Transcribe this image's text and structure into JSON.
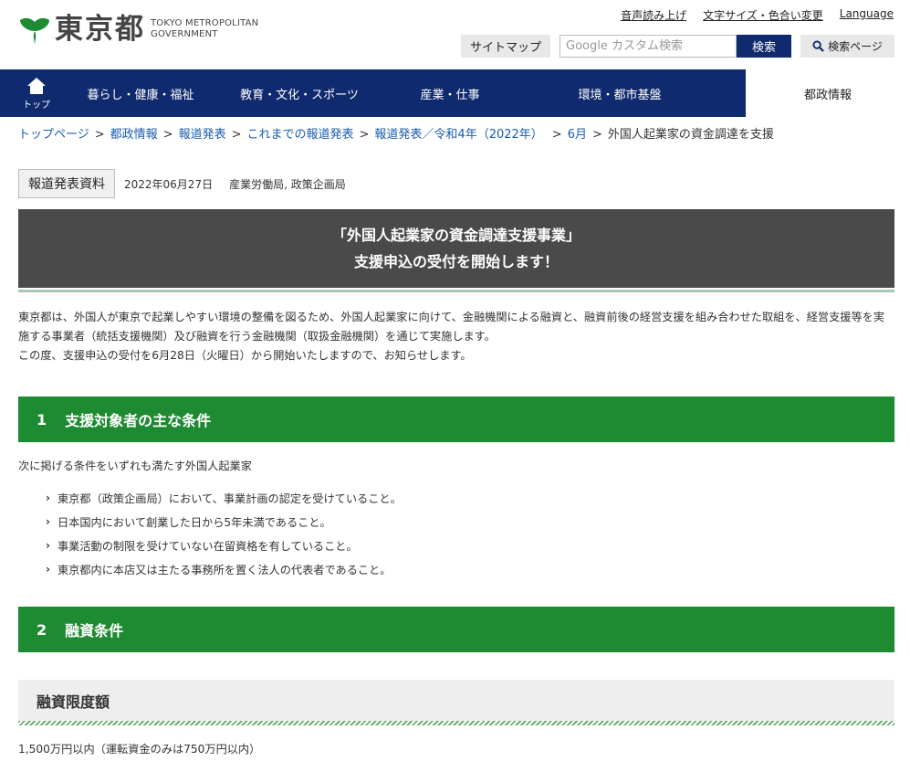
{
  "header": {
    "logo_jp": "東京都",
    "logo_en_line1": "TOKYO METROPOLITAN",
    "logo_en_line2": "GOVERNMENT",
    "util_links": [
      "音声読み上げ",
      "文字サイズ・色合い変更",
      "Language"
    ],
    "sitemap_label": "サイトマップ",
    "search_placeholder": "Google カスタム検索",
    "search_button": "検索",
    "search_page_button": "検索ページ"
  },
  "nav": {
    "home_label": "トップ",
    "items": [
      "暮らし・健康・福祉",
      "教育・文化・スポーツ",
      "産業・仕事",
      "環境・都市基盤",
      "都政情報"
    ]
  },
  "breadcrumb": [
    "トップページ",
    "都政情報",
    "報道発表",
    "これまでの報道発表",
    "報道発表／令和4年（2022年）",
    "6月",
    "外国人起業家の資金調達を支援"
  ],
  "meta": {
    "badge": "報道発表資料",
    "date": "2022年06月27日",
    "departments": "産業労働局, 政策企画局"
  },
  "title": {
    "line1": "「外国人起業家の資金調達支援事業」",
    "line2": "支援申込の受付を開始します！"
  },
  "intro": {
    "para1": "東京都は、外国人が東京で起業しやすい環境の整備を図るため、外国人起業家に向けて、金融機関による融資と、融資前後の経営支援を組み合わせた取組を、経営支援等を実施する事業者（統括支援機関）及び融資を行う金融機関（取扱金融機関）を通じて実施します。",
    "para2": "この度、支援申込の受付を6月28日（火曜日）から開始いたしますので、お知らせします。"
  },
  "section1": {
    "num": "1",
    "title": "支援対象者の主な条件",
    "lead": "次に掲げる条件をいずれも満たす外国人起業家",
    "conditions": [
      "東京都（政策企画局）において、事業計画の認定を受けていること。",
      "日本国内において創業した日から5年未満であること。",
      "事業活動の制限を受けていない在留資格を有していること。",
      "東京都内に本店又は主たる事務所を置く法人の代表者であること。"
    ]
  },
  "section2": {
    "num": "2",
    "title": "融資条件",
    "sub_title": "融資限度額",
    "limit_text": "1,500万円以内（運転資金のみは750万円以内）"
  },
  "colors": {
    "nav_bg": "#0f2a6e",
    "section_green": "#1e8a32",
    "logo_green": "#1e8a32",
    "link_blue": "#1a5bb0",
    "title_bg": "#4a4a4a"
  }
}
